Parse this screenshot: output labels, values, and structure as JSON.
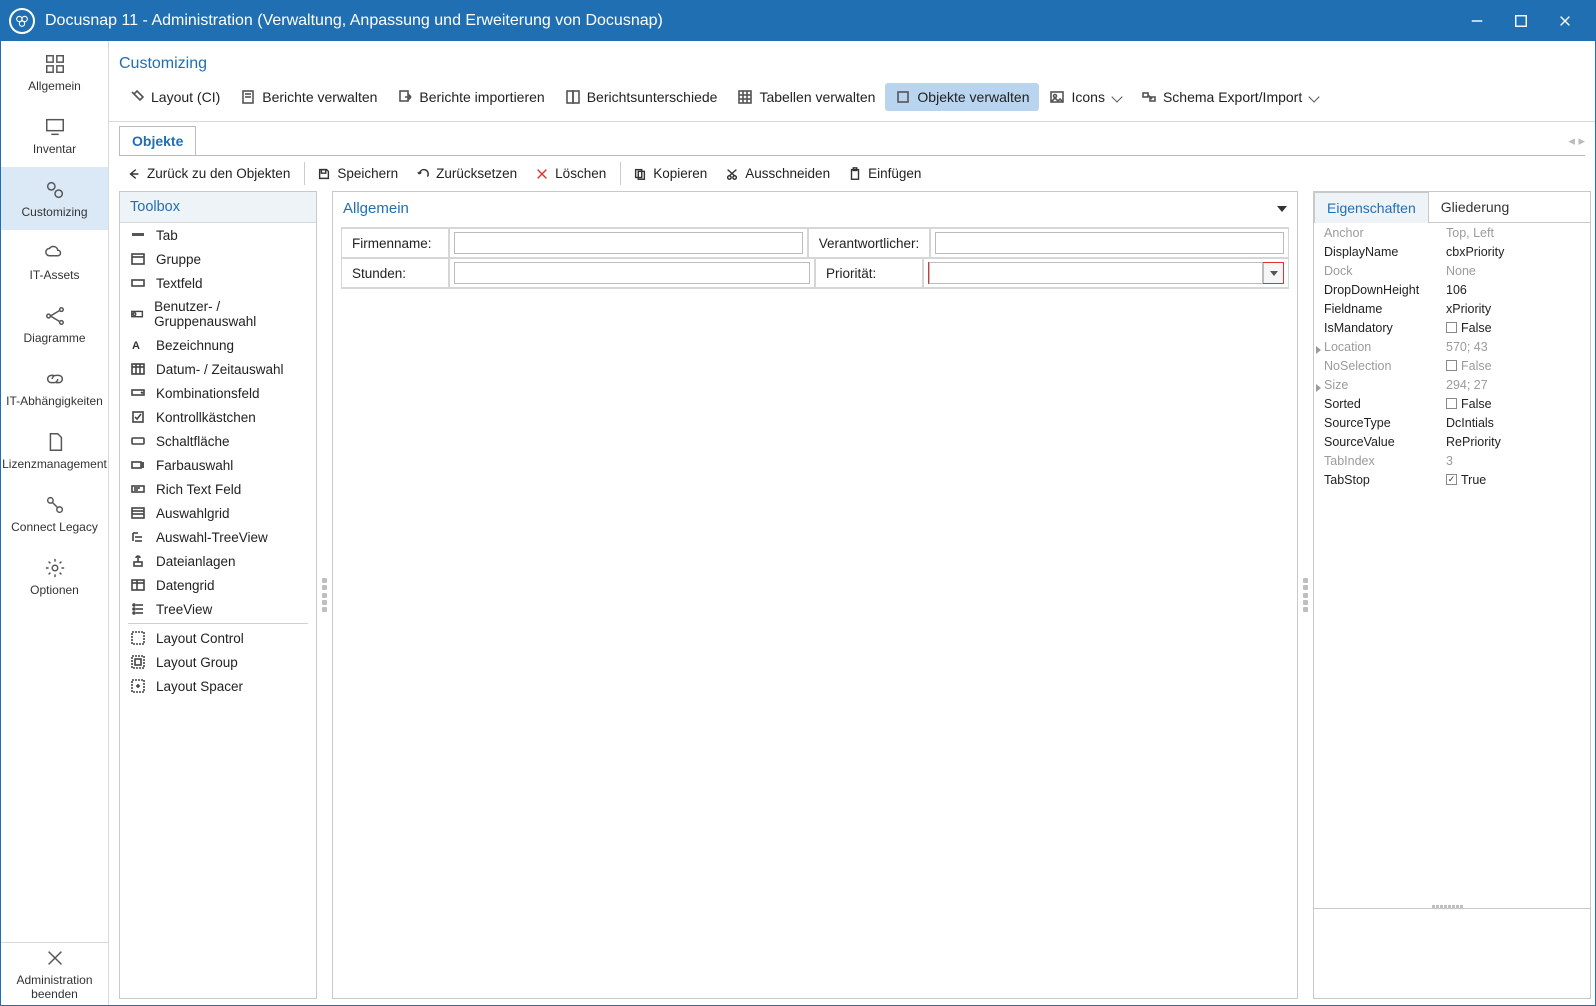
{
  "window": {
    "title": "Docusnap 11 - Administration (Verwaltung, Anpassung und Erweiterung von Docusnap)"
  },
  "sidebar": {
    "items": [
      {
        "label": "Allgemein",
        "icon": "grid-icon"
      },
      {
        "label": "Inventar",
        "icon": "monitor-icon"
      },
      {
        "label": "Customizing",
        "icon": "gears-icon"
      },
      {
        "label": "IT-Assets",
        "icon": "cloud-link-icon"
      },
      {
        "label": "Diagramme",
        "icon": "nodes-icon"
      },
      {
        "label": "IT-Abhängigkeiten",
        "icon": "link-icon"
      },
      {
        "label": "Lizenzmanagement",
        "icon": "document-icon"
      },
      {
        "label": "Connect Legacy",
        "icon": "connect-icon"
      },
      {
        "label": "Optionen",
        "icon": "gear-icon"
      }
    ],
    "active_index": 2,
    "bottom": {
      "label1": "Administration",
      "label2": "beenden",
      "icon": "close-icon"
    }
  },
  "breadcrumb": "Customizing",
  "ribbon": {
    "items": [
      {
        "label": "Layout (CI)",
        "icon": "paint-icon"
      },
      {
        "label": "Berichte verwalten",
        "icon": "report-icon"
      },
      {
        "label": "Berichte importieren",
        "icon": "report-import-icon"
      },
      {
        "label": "Berichtsunterschiede",
        "icon": "report-diff-icon"
      },
      {
        "label": "Tabellen verwalten",
        "icon": "table-icon"
      },
      {
        "label": "Objekte verwalten",
        "icon": "object-icon"
      },
      {
        "label": "Icons",
        "icon": "image-icon",
        "dropdown": true
      },
      {
        "label": "Schema Export/Import",
        "icon": "schema-icon",
        "dropdown": true
      }
    ],
    "active_index": 5
  },
  "tab": {
    "label": "Objekte"
  },
  "subbar": {
    "items": [
      {
        "label": "Zurück zu den Objekten",
        "icon": "back-arrow-icon"
      },
      {
        "label": "Speichern",
        "icon": "save-icon"
      },
      {
        "label": "Zurücksetzen",
        "icon": "undo-icon"
      },
      {
        "label": "Löschen",
        "icon": "delete-icon",
        "red": true
      },
      {
        "label": "Kopieren",
        "icon": "copy-icon"
      },
      {
        "label": "Ausschneiden",
        "icon": "cut-icon"
      },
      {
        "label": "Einfügen",
        "icon": "paste-icon"
      }
    ]
  },
  "toolbox": {
    "title": "Toolbox",
    "items": [
      "Tab",
      "Gruppe",
      "Textfeld",
      "Benutzer- / Gruppenauswahl",
      "Bezeichnung",
      "Datum- / Zeitauswahl",
      "Kombinationsfeld",
      "Kontrollkästchen",
      "Schaltfläche",
      "Farbauswahl",
      "Rich Text Feld",
      "Auswahlgrid",
      "Auswahl-TreeView",
      "Dateianlagen",
      "Datengrid",
      "TreeView",
      "Layout Control",
      "Layout Group",
      "Layout Spacer"
    ]
  },
  "designer": {
    "title": "Allgemein",
    "fields": {
      "firmenname_label": "Firmenname:",
      "verantwortlicher_label": "Verantwortlicher:",
      "stunden_label": "Stunden:",
      "prioritaet_label": "Priorität:"
    }
  },
  "props": {
    "tabs": [
      "Eigenschaften",
      "Gliederung"
    ],
    "active_tab": 0,
    "rows": [
      {
        "name": "Anchor",
        "value": "Top, Left",
        "disabled": true
      },
      {
        "name": "DisplayName",
        "value": "cbxPriority"
      },
      {
        "name": "Dock",
        "value": "None",
        "disabled": true
      },
      {
        "name": "DropDownHeight",
        "value": "106"
      },
      {
        "name": "Fieldname",
        "value": "xPriority"
      },
      {
        "name": "IsMandatory",
        "value": "False",
        "checkbox": true,
        "checked": false
      },
      {
        "name": "Location",
        "value": "570; 43",
        "disabled": true,
        "expander": true
      },
      {
        "name": "NoSelection",
        "value": "False",
        "disabled": true,
        "checkbox": true,
        "checked": false
      },
      {
        "name": "Size",
        "value": "294; 27",
        "disabled": true,
        "expander": true
      },
      {
        "name": "Sorted",
        "value": "False",
        "checkbox": true,
        "checked": false
      },
      {
        "name": "SourceType",
        "value": "DcIntials"
      },
      {
        "name": "SourceValue",
        "value": "RePriority"
      },
      {
        "name": "TabIndex",
        "value": "3",
        "disabled": true
      },
      {
        "name": "TabStop",
        "value": "True",
        "checkbox": true,
        "checked": true
      }
    ]
  }
}
